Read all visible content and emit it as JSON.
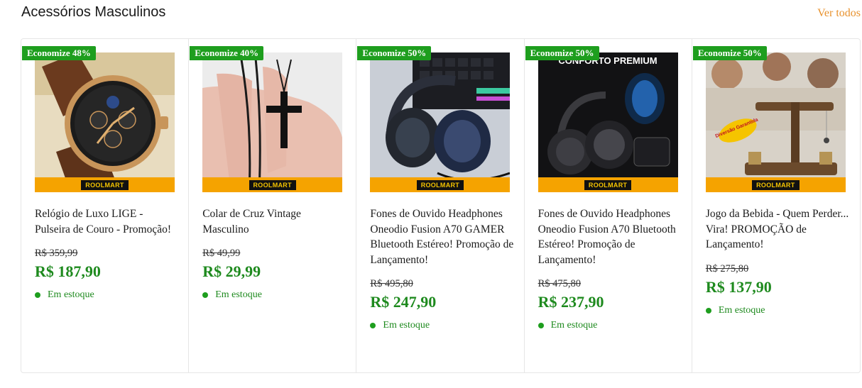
{
  "section": {
    "title": "Acessórios Masculinos",
    "see_all": "Ver todos"
  },
  "brand_label": "ROOLMART",
  "products": [
    {
      "badge": "Economize 48%",
      "name": "Relógio de Luxo LIGE - Pulseira de Couro - Promoção!",
      "old_price": "R$ 359,99",
      "price": "R$ 187,90",
      "stock": "Em estoque"
    },
    {
      "badge": "Economize 40%",
      "name": "Colar de Cruz Vintage Masculino",
      "old_price": "R$ 49,99",
      "price": "R$ 29,99",
      "stock": "Em estoque"
    },
    {
      "badge": "Economize 50%",
      "name": "Fones de Ouvido Headphones Oneodio Fusion A70 GAMER Bluetooth Estéreo! Promoção de Lançamento!",
      "old_price": "R$ 495,80",
      "price": "R$ 247,90",
      "stock": "Em estoque"
    },
    {
      "badge": "Economize 50%",
      "name": "Fones de Ouvido Headphones Oneodio Fusion A70 Bluetooth Estéreo! Promoção de Lançamento!",
      "old_price": "R$ 475,80",
      "price": "R$ 237,90",
      "stock": "Em estoque",
      "image_text": "CONFORTO PREMIUM"
    },
    {
      "badge": "Economize 50%",
      "name": "Jogo da Bebida - Quem Perder... Vira! PROMOÇÃO de Lançamento!",
      "old_price": "R$ 275,80",
      "price": "R$ 137,90",
      "stock": "Em estoque",
      "image_text": "Diversão Garantida"
    }
  ],
  "colors": {
    "accent": "#e8922e",
    "badge": "#1e9e1e",
    "price": "#1e8a1e",
    "brand_bar": "#f5a300"
  }
}
